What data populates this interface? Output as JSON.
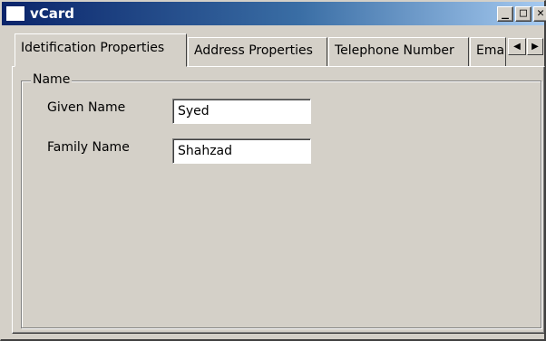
{
  "window": {
    "title": "vCard",
    "minimize_glyph": "_",
    "maximize_glyph": "□",
    "close_glyph": "✕"
  },
  "tabs": [
    {
      "label": "Idetification Properties",
      "active": true
    },
    {
      "label": "Address Properties",
      "active": false
    },
    {
      "label": "Telephone Number",
      "active": false
    },
    {
      "label": "Ema",
      "active": false
    }
  ],
  "tab_scroll": {
    "left_glyph": "◀",
    "right_glyph": "▶"
  },
  "name_group": {
    "legend": "Name",
    "given_name_label": "Given Name",
    "given_name_value": "Syed",
    "family_name_label": "Family Name",
    "family_name_value": "Shahzad"
  },
  "colors": {
    "title_bar_start": "#0a246a",
    "title_bar_end": "#a6caf0",
    "window_face": "#d4d0c8"
  }
}
